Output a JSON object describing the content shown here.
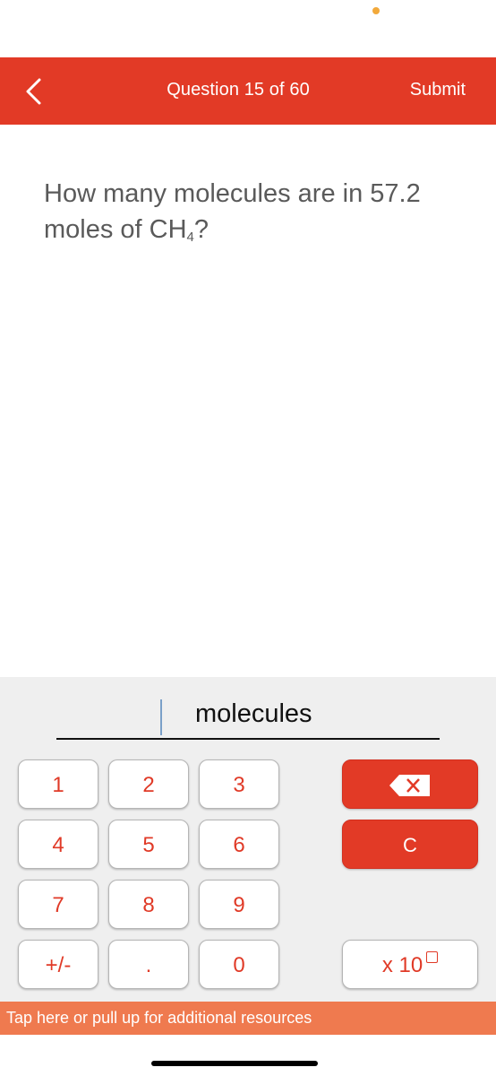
{
  "header": {
    "back_icon": "chevron-left-icon",
    "title": "Question 15 of 60",
    "submit_label": "Submit",
    "color": "#e23a26"
  },
  "question": {
    "text_before": "How many molecules are in 57.2 moles of CH",
    "subscript": "4",
    "text_after": "?"
  },
  "answer": {
    "value": "",
    "unit": "molecules"
  },
  "keypad": {
    "digits": [
      [
        "1",
        "2",
        "3"
      ],
      [
        "4",
        "5",
        "6"
      ],
      [
        "7",
        "8",
        "9"
      ],
      [
        "+/-",
        ".",
        "0"
      ]
    ],
    "backspace_icon": "backspace-icon",
    "clear_label": "C",
    "exponent_label": "x 10",
    "exponent_icon": "exponent-box-icon",
    "key_text_color": "#e03a27"
  },
  "resources_bar": {
    "label": "Tap here or pull up for additional resources",
    "color": "#ef7a4f"
  }
}
